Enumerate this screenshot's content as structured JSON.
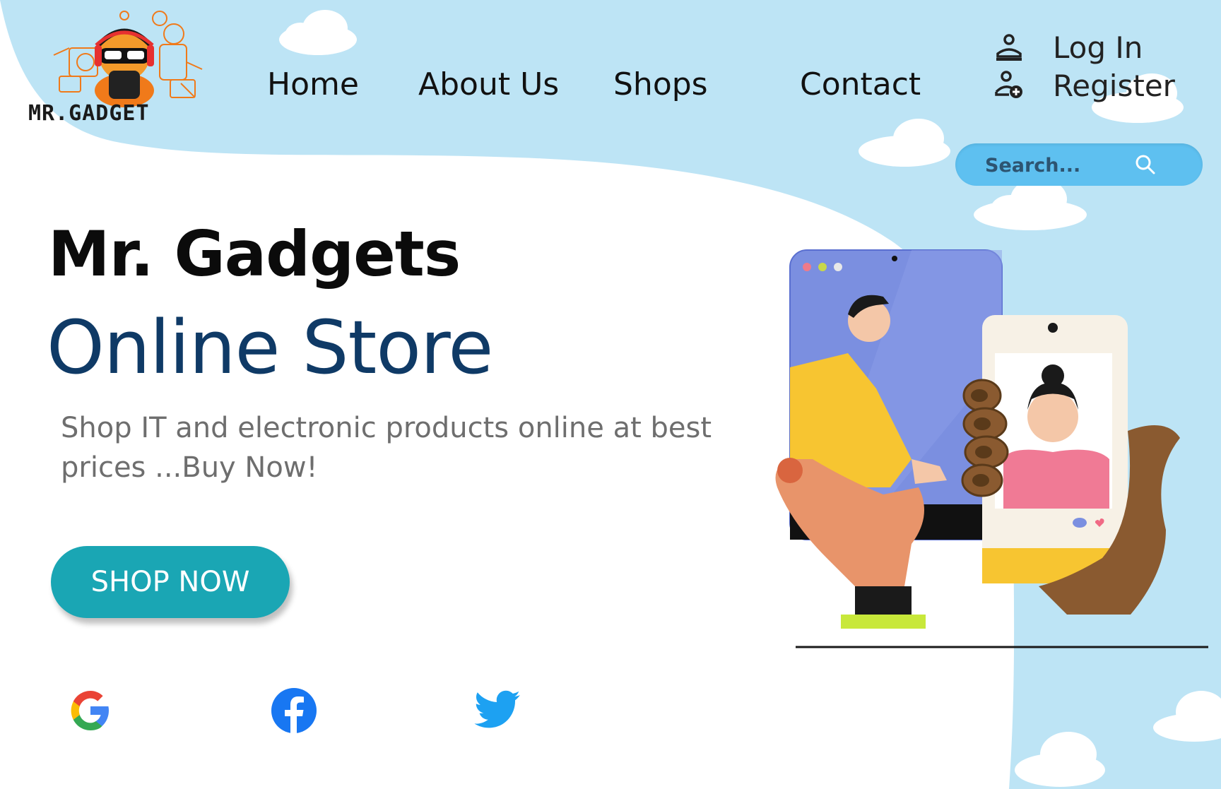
{
  "brand": {
    "logo_text": "MR.GADGET",
    "accent_color": "#f07a1a",
    "sky_color": "#bde4f5"
  },
  "nav": {
    "items": [
      {
        "label": "Home"
      },
      {
        "label": "About Us"
      },
      {
        "label": "Shops"
      },
      {
        "label": "Contact"
      }
    ]
  },
  "auth": {
    "login_label": "Log In",
    "login_icon": "user-icon",
    "register_label": "Register",
    "register_icon": "user-add-icon"
  },
  "search": {
    "placeholder": "Search...",
    "icon": "search-icon"
  },
  "hero": {
    "title": "Mr. Gadgets",
    "subtitle": "Online Store",
    "description": "Shop IT and electronic products online at best prices ...Buy Now!",
    "cta_label": "SHOP NOW",
    "cta_color": "#1aa6b4"
  },
  "social": [
    {
      "name": "google-icon"
    },
    {
      "name": "facebook-icon"
    },
    {
      "name": "twitter-icon"
    }
  ]
}
